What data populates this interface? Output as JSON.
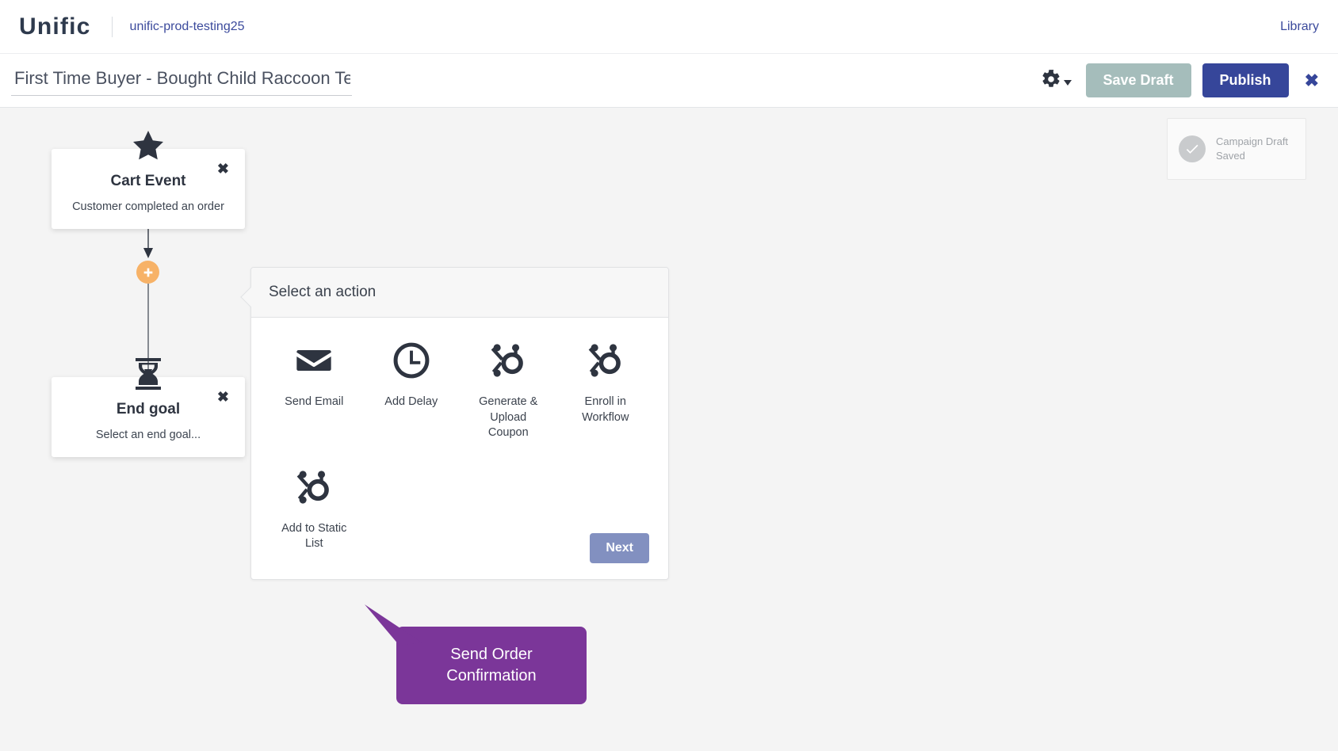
{
  "header": {
    "brand": "Unific",
    "account": "unific-prod-testing25",
    "library_label": "Library"
  },
  "subheader": {
    "campaign_title": "First Time Buyer - Bought Child Raccoon Tee",
    "campaign_title_placeholder": "Campaign name",
    "gear_icon": "gear-icon",
    "save_draft_label": "Save Draft",
    "publish_label": "Publish",
    "close_label": "✖"
  },
  "toast": {
    "icon": "check-circle-icon",
    "message": "Campaign Draft Saved"
  },
  "flow": {
    "nodes": [
      {
        "id": "cart-event",
        "icon": "star-icon",
        "title": "Cart Event",
        "subtitle": "Customer completed an order",
        "close_label": "✖"
      },
      {
        "id": "end-goal",
        "icon": "hourglass-icon",
        "title": "End goal",
        "subtitle": "Select an end goal...",
        "close_label": "✖"
      }
    ],
    "add_step_icon": "plus-icon"
  },
  "action_panel": {
    "header": "Select an action",
    "actions": [
      {
        "label": "Send Email",
        "icon": "envelope-icon"
      },
      {
        "label": "Add Delay",
        "icon": "clock-icon"
      },
      {
        "label": "Generate & Upload Coupon",
        "icon": "hubspot-sprocket-icon"
      },
      {
        "label": "Enroll in Workflow",
        "icon": "hubspot-sprocket-icon"
      },
      {
        "label": "Add to Static List",
        "icon": "hubspot-sprocket-icon"
      }
    ],
    "callout": "Send Order Confirmation",
    "next_label": "Next"
  },
  "colors": {
    "brand_navy": "#2e3a4d",
    "link_blue": "#3b4a9c",
    "publish_blue": "#36469a",
    "save_draft_gray": "#a5bdbb",
    "plus_orange": "#f7b267",
    "callout_purple": "#7b3699",
    "next_blue": "#8290c0",
    "canvas_gray": "#f4f4f4"
  }
}
